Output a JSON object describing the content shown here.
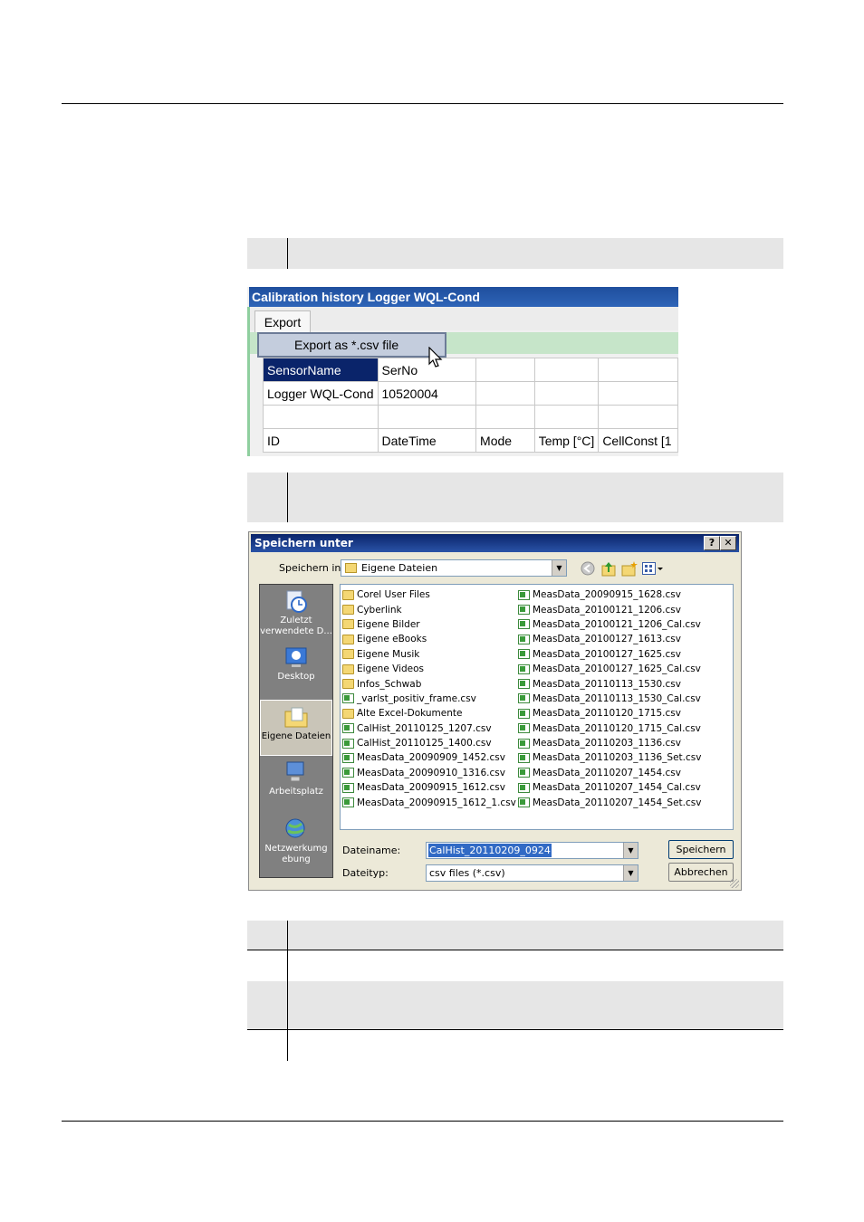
{
  "calibration_window": {
    "title": "Calibration history Logger WQL-Cond",
    "menu_export": "Export",
    "menu_item_export_csv": "Export as *.csv file",
    "table": {
      "rows": [
        [
          "SensorName",
          "SerNo",
          "",
          "",
          ""
        ],
        [
          "Logger WQL-Cond",
          "10520004",
          "",
          "",
          ""
        ],
        [
          "",
          "",
          "",
          "",
          ""
        ],
        [
          "ID",
          "DateTime",
          "Mode",
          "Temp [°C]",
          "CellConst [1"
        ]
      ]
    }
  },
  "save_dialog": {
    "title": "Speichern unter",
    "help_button": "?",
    "close_button": "✕",
    "save_in_label": "Speichern in:",
    "save_in_value": "Eigene Dateien",
    "places": [
      {
        "label": "Zuletzt verwendete D...",
        "icon": "recent-icon"
      },
      {
        "label": "Desktop",
        "icon": "desktop-icon"
      },
      {
        "label": "Eigene Dateien",
        "icon": "my-documents-icon"
      },
      {
        "label": "Arbeitsplatz",
        "icon": "my-computer-icon"
      },
      {
        "label": "Netzwerkumgebung",
        "icon": "network-icon"
      }
    ],
    "files_col1": [
      {
        "name": "Corel User Files",
        "type": "folder"
      },
      {
        "name": "Cyberlink",
        "type": "folder"
      },
      {
        "name": "Eigene Bilder",
        "type": "folder"
      },
      {
        "name": "Eigene eBooks",
        "type": "folder"
      },
      {
        "name": "Eigene Musik",
        "type": "folder"
      },
      {
        "name": "Eigene Videos",
        "type": "folder"
      },
      {
        "name": "Infos_Schwab",
        "type": "folder"
      },
      {
        "name": "_varlst_positiv_frame.csv",
        "type": "csv"
      },
      {
        "name": "Alte Excel-Dokumente",
        "type": "folder"
      },
      {
        "name": "CalHist_20110125_1207.csv",
        "type": "csv"
      },
      {
        "name": "CalHist_20110125_1400.csv",
        "type": "csv"
      },
      {
        "name": "MeasData_20090909_1452.csv",
        "type": "csv"
      },
      {
        "name": "MeasData_20090910_1316.csv",
        "type": "csv"
      },
      {
        "name": "MeasData_20090915_1612.csv",
        "type": "csv"
      },
      {
        "name": "MeasData_20090915_1612_1.csv",
        "type": "csv"
      }
    ],
    "files_col2": [
      {
        "name": "MeasData_20090915_1628.csv",
        "type": "csv"
      },
      {
        "name": "MeasData_20100121_1206.csv",
        "type": "csv"
      },
      {
        "name": "MeasData_20100121_1206_Cal.csv",
        "type": "csv"
      },
      {
        "name": "MeasData_20100127_1613.csv",
        "type": "csv"
      },
      {
        "name": "MeasData_20100127_1625.csv",
        "type": "csv"
      },
      {
        "name": "MeasData_20100127_1625_Cal.csv",
        "type": "csv"
      },
      {
        "name": "MeasData_20110113_1530.csv",
        "type": "csv"
      },
      {
        "name": "MeasData_20110113_1530_Cal.csv",
        "type": "csv"
      },
      {
        "name": "MeasData_20110120_1715.csv",
        "type": "csv"
      },
      {
        "name": "MeasData_20110120_1715_Cal.csv",
        "type": "csv"
      },
      {
        "name": "MeasData_20110203_1136.csv",
        "type": "csv"
      },
      {
        "name": "MeasData_20110203_1136_Set.csv",
        "type": "csv"
      },
      {
        "name": "MeasData_20110207_1454.csv",
        "type": "csv"
      },
      {
        "name": "MeasData_20110207_1454_Cal.csv",
        "type": "csv"
      },
      {
        "name": "MeasData_20110207_1454_Set.csv",
        "type": "csv"
      }
    ],
    "filename_label": "Dateiname:",
    "filename_value": "CalHist_20110209_0924",
    "filetype_label": "Dateityp:",
    "filetype_value": "csv files (*.csv)",
    "save_button": "Speichern",
    "cancel_button": "Abbrechen"
  }
}
